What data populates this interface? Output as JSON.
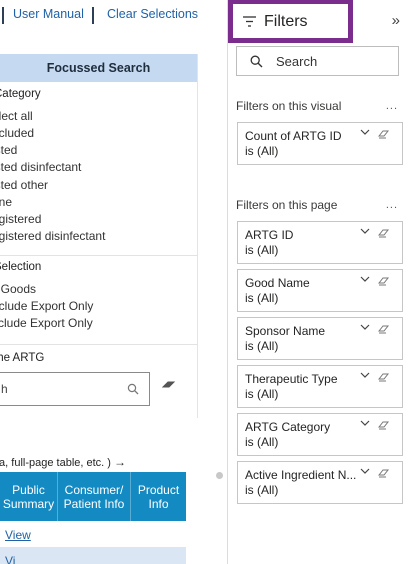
{
  "top_links": {
    "user_manual": "User Manual",
    "clear_selections": "Clear Selections"
  },
  "focussed_search": {
    "title": "Focussed Search",
    "category": {
      "title": "Category",
      "options": [
        "elect all",
        "ncluded",
        "isted",
        "isted disinfectant",
        "isted other",
        "one",
        "egistered",
        "egistered disinfectant"
      ]
    },
    "selection": {
      "title": "Selection",
      "options": [
        "ll Goods",
        "nclude Export Only",
        "xclude Export Only"
      ]
    },
    "artg_search": {
      "title": "the ARTG",
      "placeholder": "h"
    }
  },
  "results": {
    "hint": "ta, full-page table, etc. )",
    "columns": [
      "Public Summary",
      "Consumer/ Patient Info",
      "Product Info"
    ],
    "rows": [
      {
        "public_summary": "View"
      },
      {
        "public_summary": "Vi"
      }
    ]
  },
  "filter_pane": {
    "title": "Filters",
    "search_placeholder": "Search",
    "visual_section": "Filters on this visual",
    "page_section": "Filters on this page",
    "more": "...",
    "visual_filters": [
      {
        "name": "Count of ARTG ID",
        "value": "is (All)"
      }
    ],
    "page_filters": [
      {
        "name": "ARTG ID",
        "value": "is (All)"
      },
      {
        "name": "Good Name",
        "value": "is (All)"
      },
      {
        "name": "Sponsor Name",
        "value": "is (All)"
      },
      {
        "name": "Therapeutic Type",
        "value": "is (All)"
      },
      {
        "name": "ARTG Category",
        "value": "is (All)"
      },
      {
        "name": "Active Ingredient N...",
        "value": "is (All)"
      }
    ]
  },
  "colors": {
    "accent_purple": "#7b2d8e",
    "table_header": "#148ac2",
    "panel_header": "#c5d9f1",
    "link": "#2162a7"
  },
  "icons": [
    "funnel-icon",
    "chevron-right-double-icon",
    "search-icon",
    "chevron-down-icon",
    "eraser-icon",
    "arrow-right-icon"
  ]
}
